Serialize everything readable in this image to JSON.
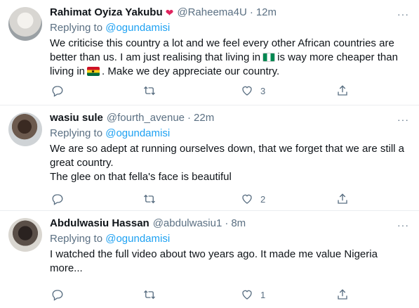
{
  "tweets": [
    {
      "name": "Rahimat Oyiza Yakubu",
      "handle": "@Raheema4U",
      "time": "12m",
      "reply_prefix": "Replying to",
      "reply_to": "@ogundamisi",
      "text_parts": [
        "We criticise this country a lot and we feel every other African countries are better than us. I am just realising that living in",
        "is way more cheaper than living in",
        ". Make we dey appreciate our country."
      ],
      "likes": "3"
    },
    {
      "name": "wasiu sule",
      "handle": "@fourth_avenue",
      "time": "22m",
      "reply_prefix": "Replying to",
      "reply_to": "@ogundamisi",
      "text_line1": "We are so adept at running ourselves down, that we forget that we are still a great country.",
      "text_line2": "The glee on that fella's face is beautiful",
      "likes": "2"
    },
    {
      "name": "Abdulwasiu Hassan",
      "handle": "@abdulwasiu1",
      "time": "8m",
      "reply_prefix": "Replying to",
      "reply_to": "@ogundamisi",
      "text": "I watched the full video about two years ago. It made me value Nigeria more...",
      "likes": "1"
    }
  ],
  "dot": "·",
  "more_glyph": "···",
  "icons": [
    "heart-emoji-icon",
    "nigeria-flag-icon",
    "ghana-flag-icon",
    "reply-icon",
    "retweet-icon",
    "like-icon",
    "share-icon",
    "more-icon"
  ]
}
